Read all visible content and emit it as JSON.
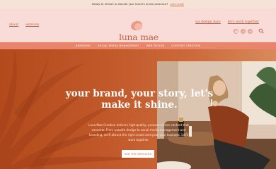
{
  "announcement": {
    "text": "Ready to refresh or elevate your brand's online presence?",
    "link": "Let's chat!"
  },
  "nav": {
    "left": [
      "about",
      "services"
    ],
    "right": [
      "via design days",
      "let's work together"
    ]
  },
  "logo": {
    "name": "luna mae",
    "tagline": "CREATIVE"
  },
  "socials": [
    "instagram-icon",
    "facebook-icon",
    "pinterest-icon"
  ],
  "subnav": [
    "BRANDING",
    "SOCIAL MEDIA MANAGEMENT",
    "WEB DESIGN",
    "CONTENT CREATION"
  ],
  "hero": {
    "headline": "your brand, your story, let's make it shine.",
    "body": "Luna Mae Creative delivers high-quality, purpose-driven content that converts. From website design to social media management and branding, we'll attract the right crowd and grow your business. Let's work together.",
    "cta": "SEE THE SERVICES"
  },
  "colors": {
    "accent": "#c5603e",
    "header_bg": "#f9dcd8",
    "subnav_bg": "#e8856a",
    "hero_bg": "#c2592a"
  }
}
